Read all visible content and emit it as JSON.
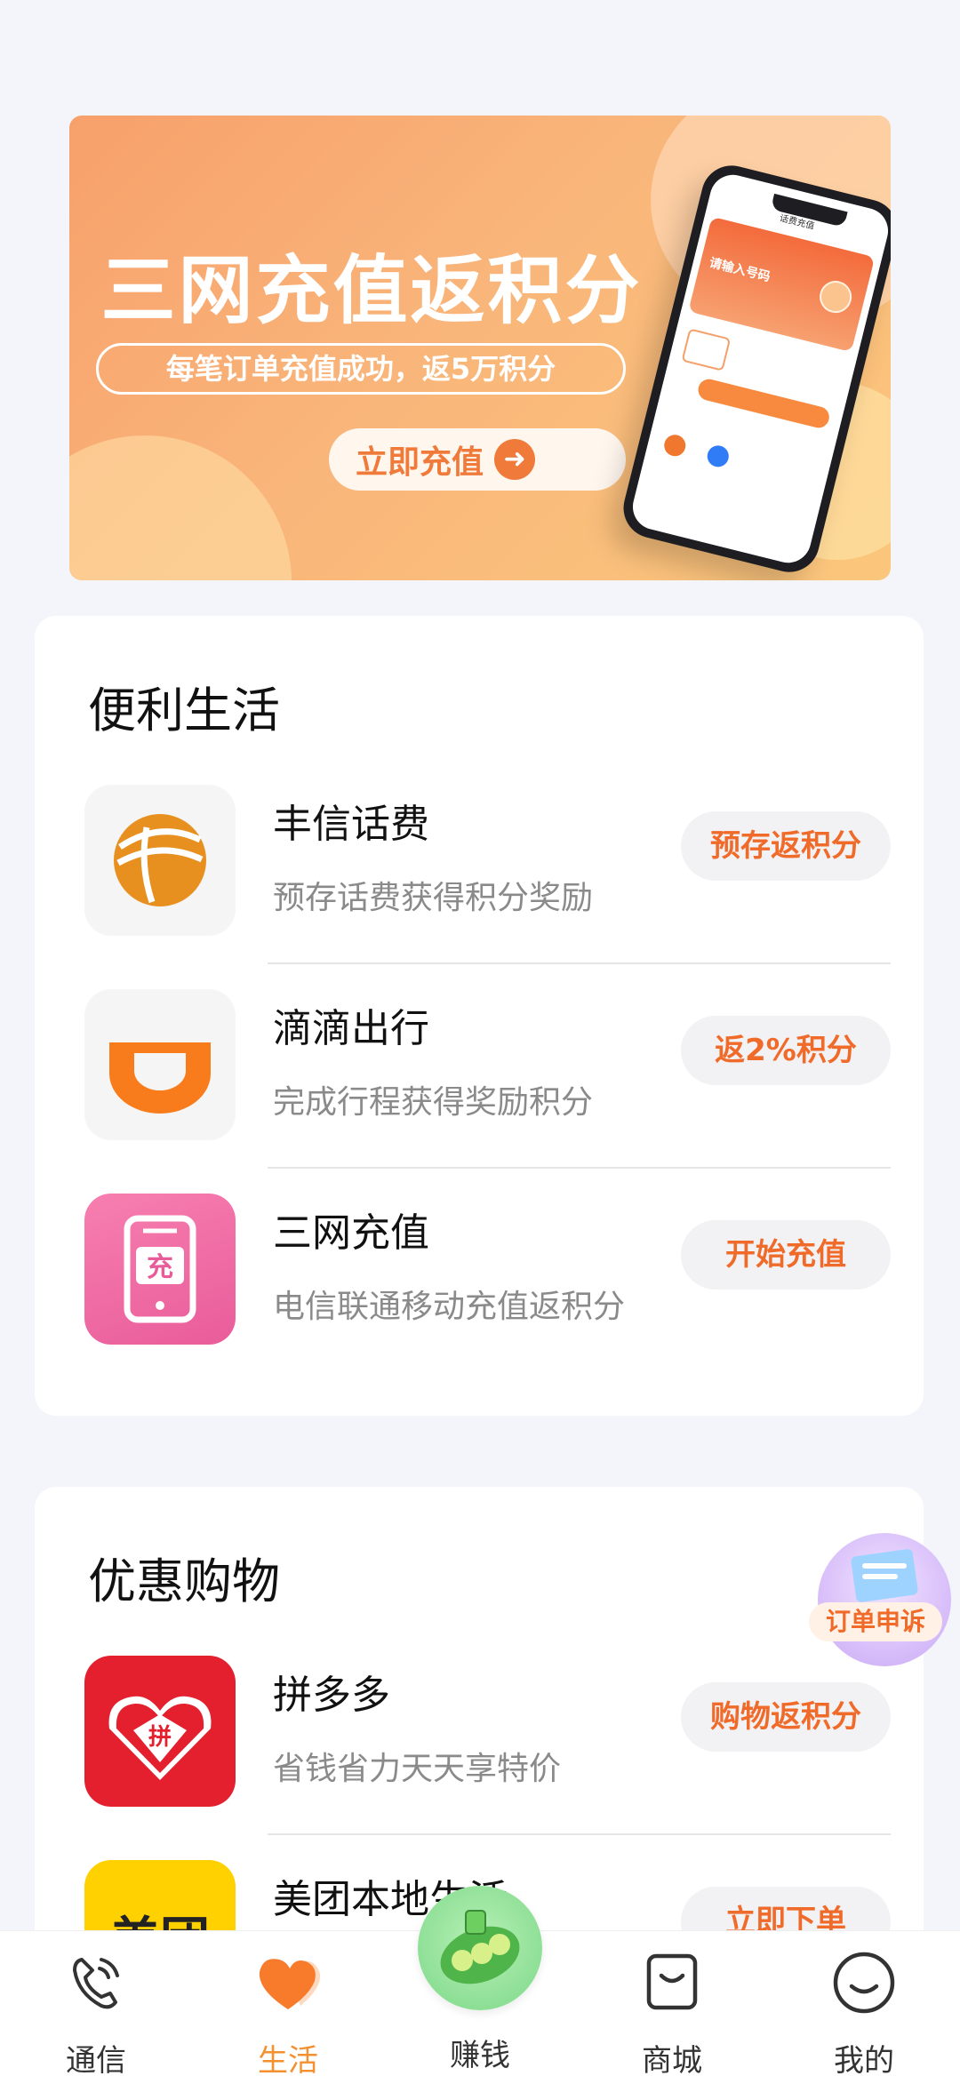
{
  "banner": {
    "title": "三网充值返积分",
    "subtitle": "每笔订单充值成功，返5万积分",
    "button_label": "立即充值",
    "phone_title": "话费充值",
    "phone_input_placeholder": "请输入号码"
  },
  "section1": {
    "title": "便利生活",
    "items": [
      {
        "name": "丰信话费",
        "desc": "预存话费获得积分奖励",
        "action": "预存返积分",
        "icon": "fengxin-logo-icon"
      },
      {
        "name": "滴滴出行",
        "desc": "完成行程获得奖励积分",
        "action": "返2%积分",
        "icon": "didi-logo-icon"
      },
      {
        "name": "三网充值",
        "desc": "电信联通移动充值返积分",
        "action": "开始充值",
        "icon": "phone-recharge-icon",
        "icon_text": "充"
      }
    ]
  },
  "section2": {
    "title": "优惠购物",
    "items": [
      {
        "name": "拼多多",
        "desc": "省钱省力天天享特价",
        "action": "购物返积分",
        "icon": "pinduoduo-logo-icon",
        "icon_text": "拼"
      },
      {
        "name": "美团本地生活",
        "desc": "",
        "action": "立即下单",
        "icon": "meituan-logo-icon",
        "icon_text": "美团"
      }
    ]
  },
  "floating": {
    "label": "订单申诉"
  },
  "nav": {
    "items": [
      {
        "label": "通信",
        "icon": "phone-icon"
      },
      {
        "label": "生活",
        "icon": "heart-icon",
        "active": true
      },
      {
        "label": "赚钱",
        "icon": "peapod-icon"
      },
      {
        "label": "商城",
        "icon": "shopping-bag-icon"
      },
      {
        "label": "我的",
        "icon": "smile-face-icon"
      }
    ]
  },
  "colors": {
    "accent": "#f06a2a",
    "active_tab": "#f3902f",
    "background": "#f4f4fb"
  }
}
